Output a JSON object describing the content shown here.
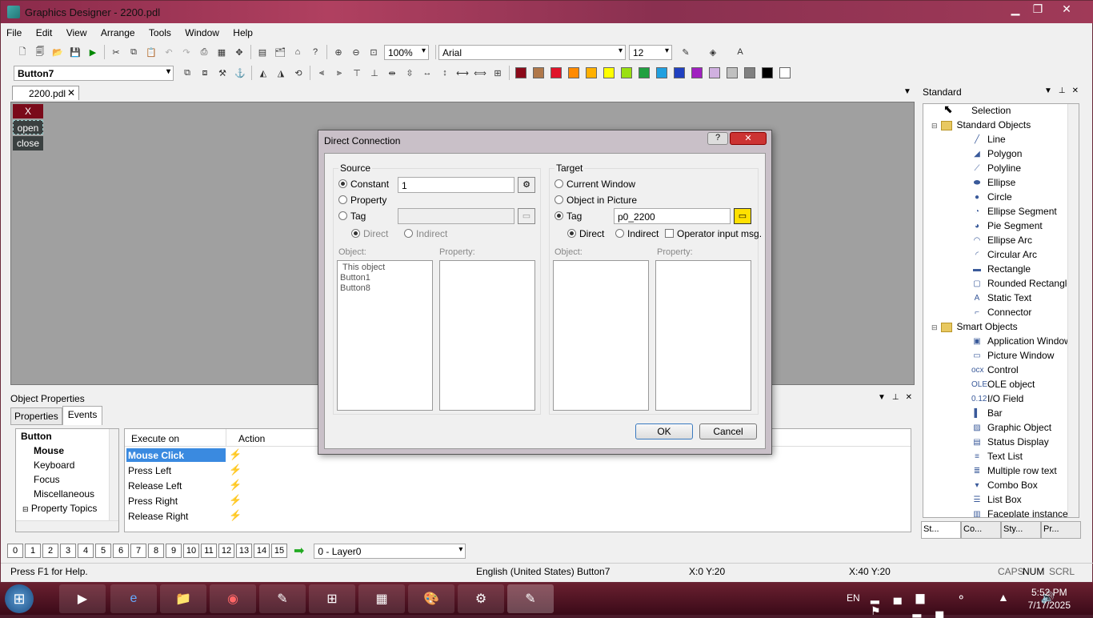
{
  "app": {
    "title": "Graphics Designer - 2200.pdl"
  },
  "menu": [
    "File",
    "Edit",
    "View",
    "Arrange",
    "Tools",
    "Window",
    "Help"
  ],
  "toolbar": {
    "zoom": "100%",
    "font": "Arial",
    "font_size": "12",
    "object_selector": "Button7"
  },
  "palette": [
    "#8b0a1a",
    "#b0784a",
    "#e0142a",
    "#ff8a00",
    "#ffb000",
    "#ffff00",
    "#9ae010",
    "#20a040",
    "#20a0e0",
    "#2040c0",
    "#a020c0",
    "#d0b0e0",
    "#c0c0c0",
    "#808080",
    "#000000",
    "#ffffff"
  ],
  "document": {
    "tab": "2200.pdl",
    "buttons": {
      "x": "X",
      "open": "open",
      "close": "close"
    }
  },
  "object_properties": {
    "title": "Object Properties",
    "tabs": [
      "Properties",
      "Events"
    ],
    "tree": [
      "Button",
      "Mouse",
      "Keyboard",
      "Focus",
      "Miscellaneous",
      "Property Topics"
    ],
    "columns": [
      "Execute on",
      "Action"
    ],
    "rows": [
      "Mouse Click",
      "Press Left",
      "Release Left",
      "Press Right",
      "Release Right"
    ]
  },
  "layers": {
    "numbers": [
      "0",
      "1",
      "2",
      "3",
      "4",
      "5",
      "6",
      "7",
      "8",
      "9",
      "10",
      "11",
      "12",
      "13",
      "14",
      "15"
    ],
    "current": "0 - Layer0"
  },
  "status": {
    "help": "Press F1 for Help.",
    "language": "English (United States)",
    "object": "Button7",
    "pos": "X:0 Y:20",
    "size": "X:40 Y:20",
    "caps": "CAPS",
    "num": "NUM",
    "scrl": "SCRL"
  },
  "standard": {
    "title": "Standard",
    "items": [
      {
        "label": "Selection",
        "level": 0,
        "icon": "cursor-icon"
      },
      {
        "label": "Standard Objects",
        "level": 0,
        "icon": "folder-icon"
      },
      {
        "label": "Line",
        "level": 1,
        "icon": "line-icon"
      },
      {
        "label": "Polygon",
        "level": 1,
        "icon": "polygon-icon"
      },
      {
        "label": "Polyline",
        "level": 1,
        "icon": "polyline-icon"
      },
      {
        "label": "Ellipse",
        "level": 1,
        "icon": "ellipse-icon"
      },
      {
        "label": "Circle",
        "level": 1,
        "icon": "circle-icon"
      },
      {
        "label": "Ellipse Segment",
        "level": 1,
        "icon": "ellipse-segment-icon"
      },
      {
        "label": "Pie Segment",
        "level": 1,
        "icon": "pie-segment-icon"
      },
      {
        "label": "Ellipse Arc",
        "level": 1,
        "icon": "ellipse-arc-icon"
      },
      {
        "label": "Circular Arc",
        "level": 1,
        "icon": "circular-arc-icon"
      },
      {
        "label": "Rectangle",
        "level": 1,
        "icon": "rectangle-icon"
      },
      {
        "label": "Rounded Rectangle",
        "level": 1,
        "icon": "rounded-rectangle-icon"
      },
      {
        "label": "Static Text",
        "level": 1,
        "icon": "static-text-icon"
      },
      {
        "label": "Connector",
        "level": 1,
        "icon": "connector-icon"
      },
      {
        "label": "Smart Objects",
        "level": 0,
        "icon": "folder-icon"
      },
      {
        "label": "Application Window",
        "level": 1,
        "icon": "app-window-icon"
      },
      {
        "label": "Picture Window",
        "level": 1,
        "icon": "picture-window-icon"
      },
      {
        "label": "Control",
        "level": 1,
        "icon": "ocx-icon"
      },
      {
        "label": "OLE object",
        "level": 1,
        "icon": "ole-icon"
      },
      {
        "label": "I/O Field",
        "level": 1,
        "icon": "io-field-icon"
      },
      {
        "label": "Bar",
        "level": 1,
        "icon": "bar-icon"
      },
      {
        "label": "Graphic Object",
        "level": 1,
        "icon": "graphic-object-icon"
      },
      {
        "label": "Status Display",
        "level": 1,
        "icon": "status-display-icon"
      },
      {
        "label": "Text List",
        "level": 1,
        "icon": "text-list-icon"
      },
      {
        "label": "Multiple row text",
        "level": 1,
        "icon": "multirow-text-icon"
      },
      {
        "label": "Combo Box",
        "level": 1,
        "icon": "combo-box-icon"
      },
      {
        "label": "List Box",
        "level": 1,
        "icon": "list-box-icon"
      },
      {
        "label": "Faceplate instance",
        "level": 1,
        "icon": "faceplate-icon"
      }
    ],
    "tabs": [
      "St...",
      "Co...",
      "Sty...",
      "Pr..."
    ]
  },
  "dialog": {
    "title": "Direct Connection",
    "help": "?",
    "source": {
      "label": "Source",
      "constant": "Constant",
      "constant_value": "1",
      "property": "Property",
      "tag": "Tag",
      "direct": "Direct",
      "indirect": "Indirect",
      "object_label": "Object:",
      "property_label": "Property:",
      "objects": [
        "This object",
        "Button1",
        "Button8"
      ]
    },
    "target": {
      "label": "Target",
      "current_window": "Current Window",
      "object_in_picture": "Object in Picture",
      "tag": "Tag",
      "tag_value": "p0_2200",
      "direct": "Direct",
      "indirect": "Indirect",
      "operator_msg": "Operator input msg.",
      "object_label": "Object:",
      "property_label": "Property:"
    },
    "ok": "OK",
    "cancel": "Cancel"
  },
  "taskbar": {
    "lang": "EN",
    "time": "5:52 PM",
    "date": "7/17/2025"
  }
}
